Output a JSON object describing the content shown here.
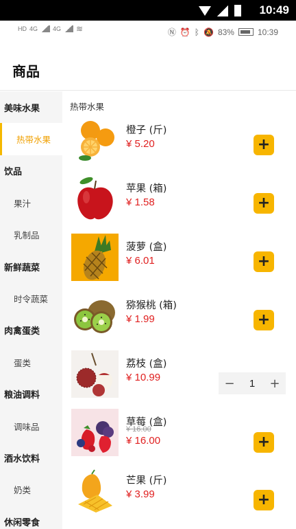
{
  "system_bar": {
    "time": "10:49"
  },
  "phone_status": {
    "battery": "83%",
    "time": "10:39",
    "left_badges": [
      "HD",
      "HD"
    ],
    "signal_labels": [
      "4G",
      "4G"
    ]
  },
  "header": {
    "title": "商品"
  },
  "sidebar": {
    "entries": [
      {
        "label": "美味水果",
        "kind": "category"
      },
      {
        "label": "热带水果",
        "kind": "sub",
        "active": true
      },
      {
        "label": "饮品",
        "kind": "category"
      },
      {
        "label": "果汁",
        "kind": "sub"
      },
      {
        "label": "乳制品",
        "kind": "sub"
      },
      {
        "label": "新鲜蔬菜",
        "kind": "category"
      },
      {
        "label": "时令蔬菜",
        "kind": "sub"
      },
      {
        "label": "肉禽蛋类",
        "kind": "category"
      },
      {
        "label": "蛋类",
        "kind": "sub"
      },
      {
        "label": "粮油调料",
        "kind": "category"
      },
      {
        "label": "调味品",
        "kind": "sub"
      },
      {
        "label": "酒水饮料",
        "kind": "category"
      },
      {
        "label": "奶类",
        "kind": "sub"
      },
      {
        "label": "休闲零食",
        "kind": "category"
      }
    ]
  },
  "main": {
    "section_title": "热带水果",
    "products": [
      {
        "name": "橙子 (斤)",
        "price": "¥ 5.20",
        "control": "add",
        "image": "orange-image"
      },
      {
        "name": "苹果 (箱)",
        "price": "¥ 1.58",
        "control": "add",
        "image": "apple-image"
      },
      {
        "name": "菠萝 (盒)",
        "price": "¥ 6.01",
        "control": "add",
        "image": "pineapple-image"
      },
      {
        "name": "猕猴桃 (箱)",
        "price": "¥ 1.99",
        "control": "add",
        "image": "kiwi-image"
      },
      {
        "name": "荔枝 (盒)",
        "price": "¥ 10.99",
        "control": "stepper",
        "quantity": "1",
        "image": "lychee-image"
      },
      {
        "name": "草莓 (盒)",
        "old_price": "¥ 16.00",
        "price": "¥ 16.00",
        "control": "add",
        "image": "strawberry-image"
      },
      {
        "name": "芒果 (斤)",
        "price": "¥ 3.99",
        "control": "add",
        "image": "mango-image"
      }
    ],
    "add_label": "+",
    "minus_label": "−",
    "plus_label": "+"
  },
  "colors": {
    "accent": "#f7b500",
    "price": "#e02020",
    "sidebar_bg": "#f5f5f5"
  }
}
